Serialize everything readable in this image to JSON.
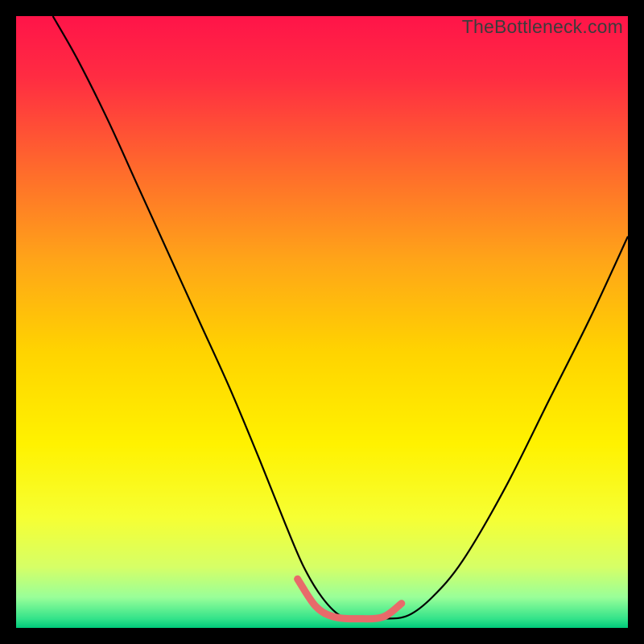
{
  "watermark": "TheBottleneck.com",
  "chart_data": {
    "type": "line",
    "title": "",
    "xlabel": "",
    "ylabel": "",
    "xlim": [
      0,
      1
    ],
    "ylim": [
      0,
      1
    ],
    "gradient_stops": [
      {
        "pos": 0.0,
        "color": "#ff1449"
      },
      {
        "pos": 0.1,
        "color": "#ff2c42"
      },
      {
        "pos": 0.25,
        "color": "#ff6a2c"
      },
      {
        "pos": 0.4,
        "color": "#ffa518"
      },
      {
        "pos": 0.55,
        "color": "#ffd400"
      },
      {
        "pos": 0.7,
        "color": "#fff200"
      },
      {
        "pos": 0.82,
        "color": "#f6ff33"
      },
      {
        "pos": 0.9,
        "color": "#d6ff66"
      },
      {
        "pos": 0.95,
        "color": "#99ff99"
      },
      {
        "pos": 0.985,
        "color": "#33e38a"
      },
      {
        "pos": 1.0,
        "color": "#00c97a"
      }
    ],
    "series": [
      {
        "name": "bottleneck-curve",
        "color": "#000000",
        "width": 2.2,
        "x": [
          0.06,
          0.1,
          0.15,
          0.2,
          0.25,
          0.3,
          0.35,
          0.4,
          0.44,
          0.47,
          0.5,
          0.53,
          0.56,
          0.6,
          0.64,
          0.68,
          0.73,
          0.8,
          0.87,
          0.94,
          1.0
        ],
        "y": [
          1.0,
          0.93,
          0.83,
          0.72,
          0.61,
          0.5,
          0.39,
          0.27,
          0.17,
          0.1,
          0.05,
          0.02,
          0.015,
          0.015,
          0.02,
          0.05,
          0.11,
          0.23,
          0.37,
          0.51,
          0.64
        ]
      },
      {
        "name": "floor-highlight",
        "color": "#e86a6a",
        "width": 9,
        "linecap": "round",
        "x": [
          0.46,
          0.49,
          0.52,
          0.56,
          0.6,
          0.63
        ],
        "y": [
          0.08,
          0.035,
          0.018,
          0.015,
          0.018,
          0.04
        ]
      }
    ]
  }
}
